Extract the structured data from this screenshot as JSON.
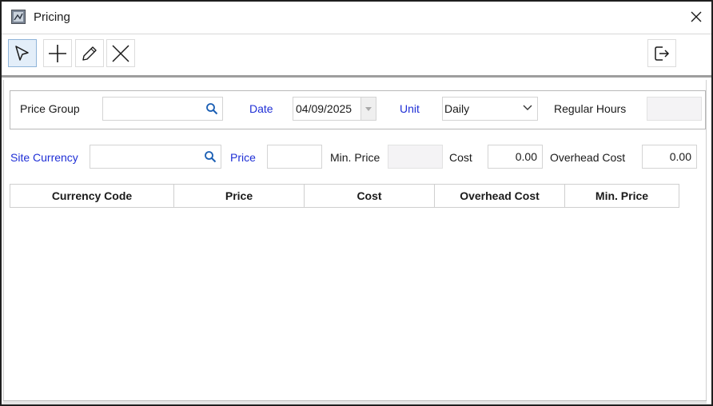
{
  "window": {
    "title": "Pricing",
    "app_icon": "pricing-app-icon",
    "close_icon": "close-icon"
  },
  "toolbar": {
    "buttons": [
      {
        "name": "select-button",
        "icon": "cursor-arrow-icon"
      },
      {
        "name": "add-button",
        "icon": "plus-icon"
      },
      {
        "name": "edit-button",
        "icon": "pencil-icon"
      },
      {
        "name": "delete-button",
        "icon": "x-icon"
      },
      {
        "name": "exit-button",
        "icon": "exit-icon"
      }
    ]
  },
  "filters": {
    "price_group": {
      "label": "Price Group",
      "value": ""
    },
    "date": {
      "label": "Date",
      "value": "04/09/2025"
    },
    "unit": {
      "label": "Unit",
      "value": "Daily"
    },
    "regular_hours": {
      "label": "Regular Hours",
      "value": ""
    }
  },
  "entry": {
    "site_currency": {
      "label": "Site Currency",
      "value": ""
    },
    "price": {
      "label": "Price",
      "value": ""
    },
    "min_price": {
      "label": "Min. Price",
      "value": ""
    },
    "cost": {
      "label": "Cost",
      "value": "0.00"
    },
    "overhead_cost": {
      "label": "Overhead Cost",
      "value": "0.00"
    }
  },
  "table": {
    "columns": [
      "Currency Code",
      "Price",
      "Cost",
      "Overhead Cost",
      "Min. Price"
    ],
    "rows": []
  },
  "colors": {
    "label_required": "#1f2fd6",
    "readonly_bg": "#f4f3f5",
    "active_tool_bg": "#e3eef9"
  }
}
